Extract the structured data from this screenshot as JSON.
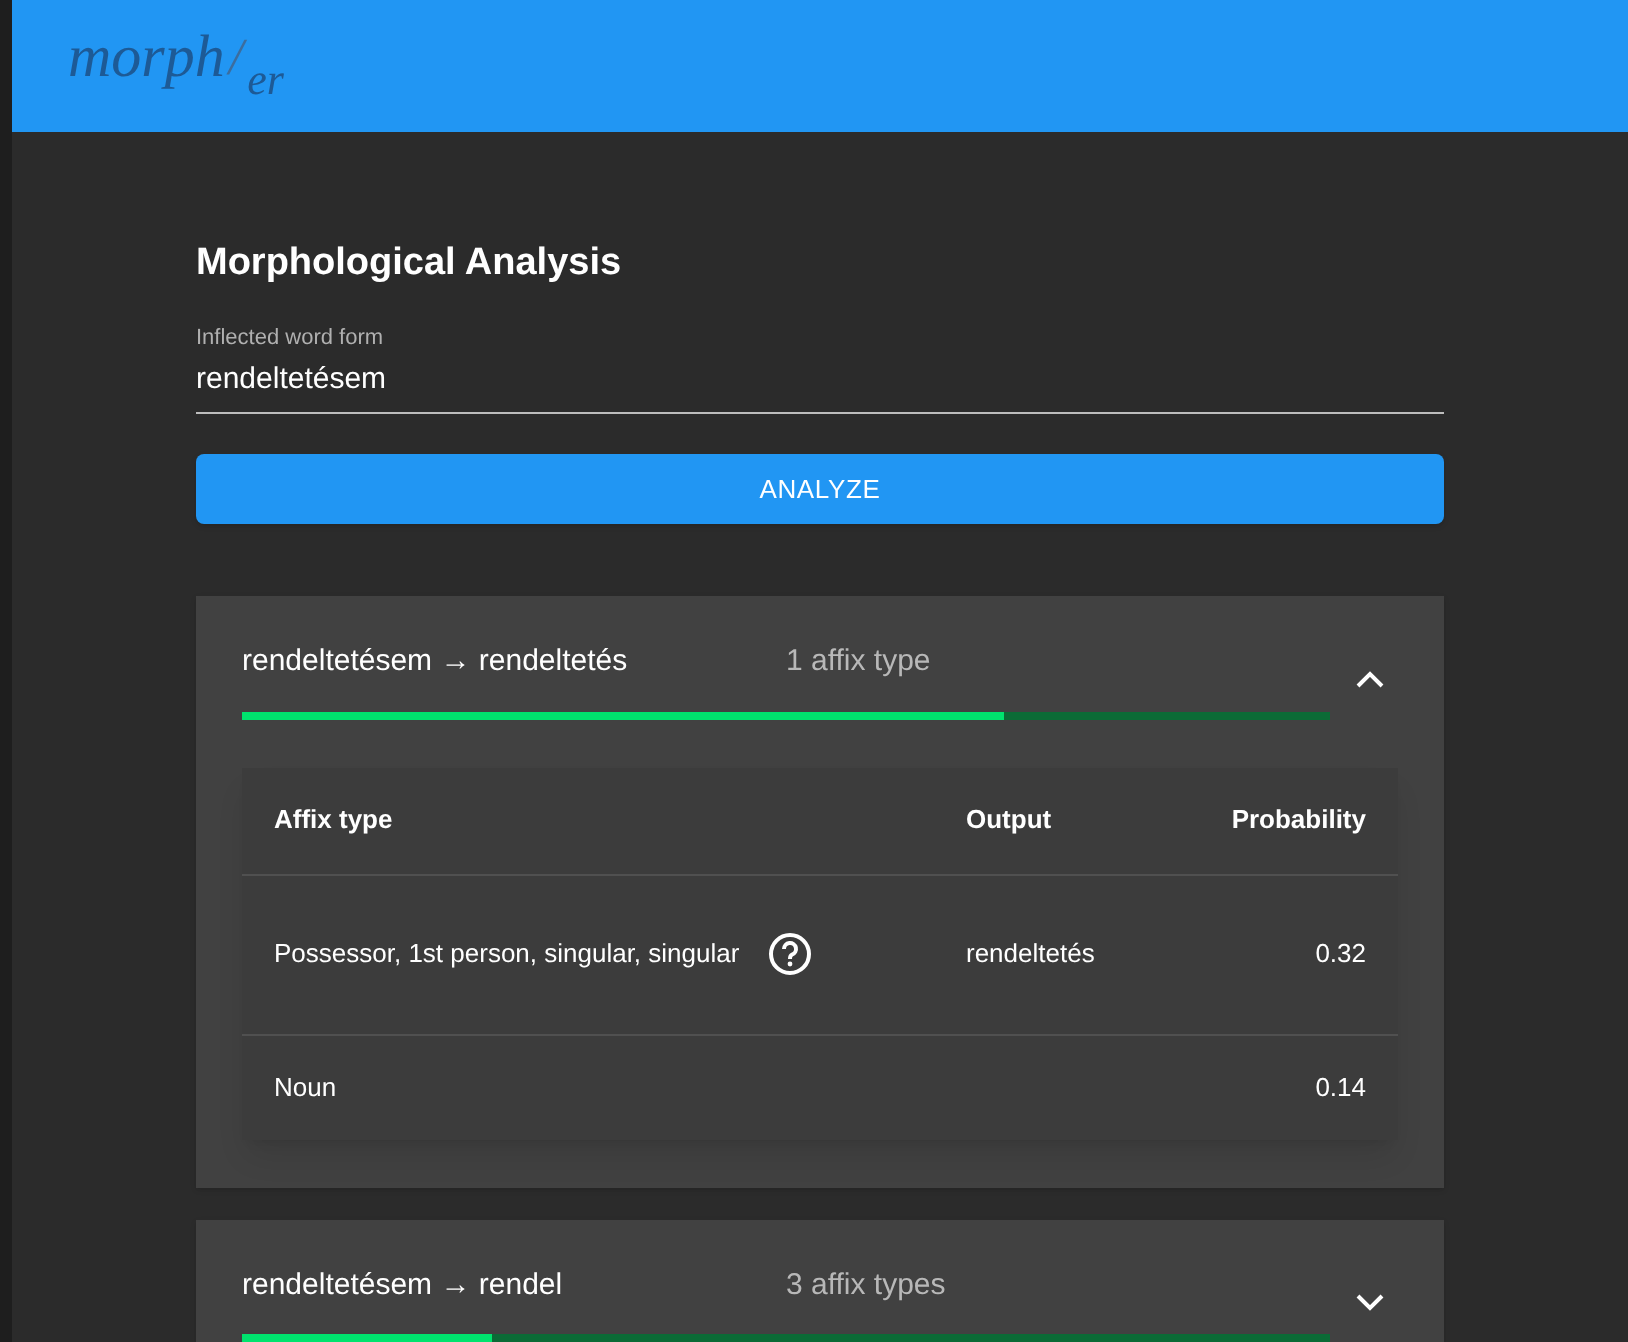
{
  "header": {
    "logo_main": "morph",
    "logo_slash": "/",
    "logo_sub": "er"
  },
  "title": "Morphological Analysis",
  "input": {
    "label": "Inflected word form",
    "value": "rendeltetésem"
  },
  "button": "ANALYZE",
  "results": [
    {
      "title": "rendeltetésem → rendeltetés",
      "count": "1 affix type",
      "level": 0.7,
      "expanded": true,
      "table": {
        "columns": [
          "Affix type",
          "Output",
          "Probability"
        ],
        "rows": [
          {
            "affix": "Possessor, 1st person, singular, singular",
            "help": true,
            "output": "rendeltetés",
            "probability": "0.32"
          },
          {
            "affix": "Noun",
            "help": false,
            "probability": "0.14"
          }
        ]
      }
    },
    {
      "title": "rendeltetésem → rendel",
      "count": "3 affix types",
      "level": 0.23,
      "expanded": false
    }
  ]
}
